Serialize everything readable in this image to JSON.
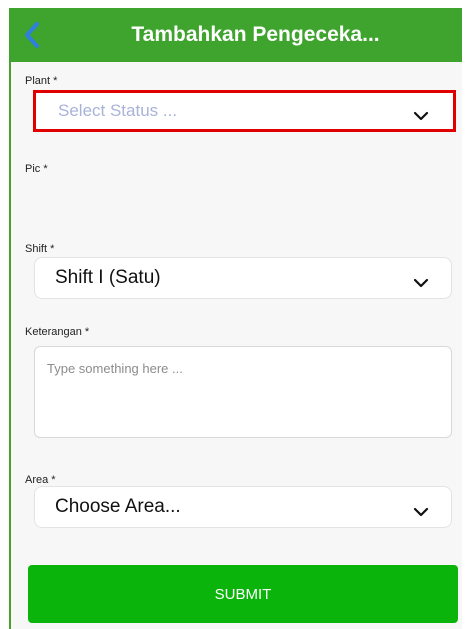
{
  "header": {
    "title": "Tambahkan Pengeceka...",
    "back_icon": "chevron-left-icon"
  },
  "form": {
    "plant": {
      "label": "Plant *",
      "placeholder": "Select Status ..."
    },
    "pic": {
      "label": "Pic *"
    },
    "shift": {
      "label": "Shift *",
      "value": "Shift I (Satu)"
    },
    "keterangan": {
      "label": "Keterangan *",
      "placeholder": "Type something here ..."
    },
    "area": {
      "label": "Area *",
      "placeholder": "Choose Area..."
    }
  },
  "submit": {
    "label": "SUBMIT"
  },
  "colors": {
    "header": "#3fa42e",
    "submit": "#0ab40a",
    "highlight": "#e00000",
    "placeholder": "#a9b3d9"
  }
}
